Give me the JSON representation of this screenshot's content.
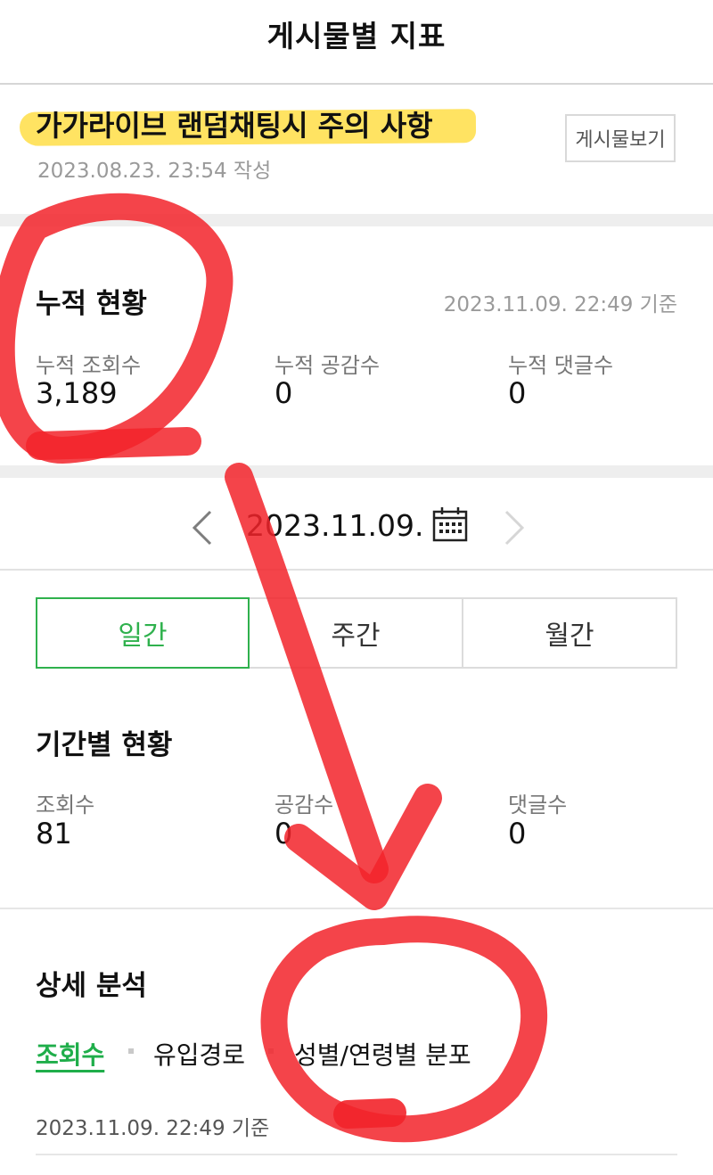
{
  "header": {
    "title": "게시물별 지표"
  },
  "post": {
    "title": "가가라이브 랜덤채팅시 주의 사항",
    "date": "2023.08.23. 23:54 작성",
    "view_button": "게시물보기"
  },
  "cumulative": {
    "title": "누적 현황",
    "basis": "2023.11.09. 22:49 기준",
    "stats": [
      {
        "label": "누적 조회수",
        "value": "3,189"
      },
      {
        "label": "누적 공감수",
        "value": "0"
      },
      {
        "label": "누적 댓글수",
        "value": "0"
      }
    ]
  },
  "date_nav": {
    "date": "2023.11.09.",
    "prev_icon": "chevron-left-icon",
    "next_icon": "chevron-right-icon",
    "calendar_icon": "calendar-icon"
  },
  "period_tabs": [
    "일간",
    "주간",
    "월간"
  ],
  "period_tab_selected": "일간",
  "period": {
    "title": "기간별 현황",
    "stats": [
      {
        "label": "조회수",
        "value": "81"
      },
      {
        "label": "공감수",
        "value": "0"
      },
      {
        "label": "댓글수",
        "value": "0"
      }
    ]
  },
  "detail": {
    "title": "상세 분석",
    "tabs": [
      "조회수",
      "유입경로",
      "성별/연령별 분포"
    ],
    "selected": "조회수",
    "basis": "2023.11.09. 22:49 기준"
  },
  "colors": {
    "accent_green": "#2fb14d",
    "highlight_yellow": "#ffe15a",
    "annotation_red": "#f2232a"
  }
}
